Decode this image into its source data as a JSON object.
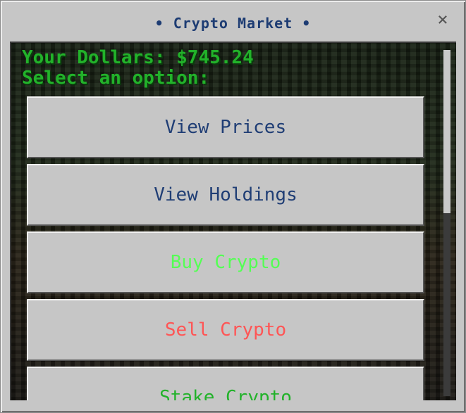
{
  "window": {
    "title": "• Crypto Market •",
    "close_glyph": "×"
  },
  "status": {
    "dollars": "Your Dollars: $745.24",
    "prompt": "Select an option:"
  },
  "menu": [
    {
      "label": "View Prices",
      "color": "#203e75"
    },
    {
      "label": "View Holdings",
      "color": "#203e75"
    },
    {
      "label": "Buy Crypto",
      "color": "#55ff55"
    },
    {
      "label": "Sell Crypto",
      "color": "#ff5555"
    },
    {
      "label": "Stake Crypto",
      "color": "#22b22a"
    }
  ],
  "colors": {
    "title": "#1d3c73",
    "status_text": "#22b22a",
    "panel": "#c6c6c6"
  }
}
